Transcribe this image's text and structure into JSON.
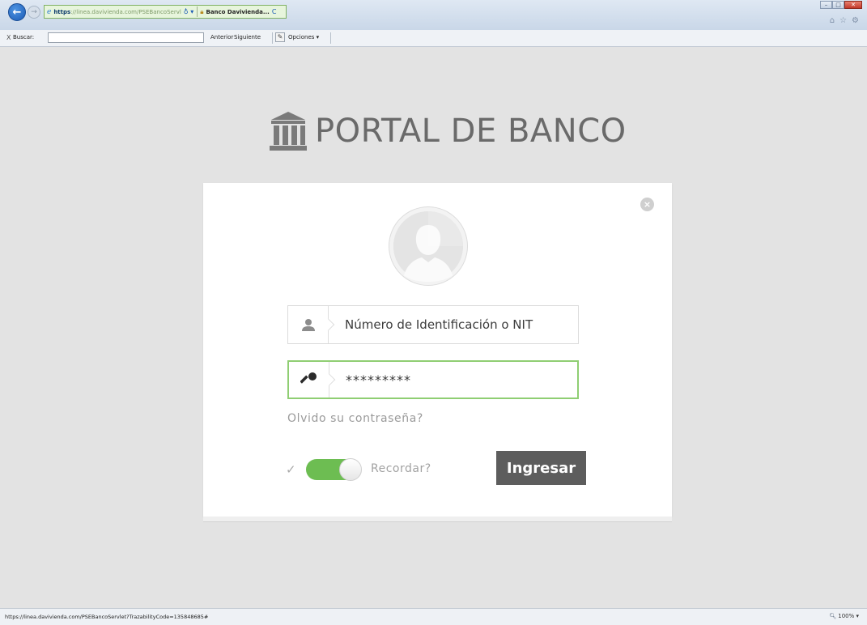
{
  "browser": {
    "url_prefix": "https",
    "url_dim": "://linea.davivienda.com/PSEBancoServl",
    "url_search": "♁ ▾",
    "tab_title": "Banco Davivienda...",
    "tab_refresh": "C",
    "win_minimize": "–",
    "win_maximize": "□",
    "win_close": "✕",
    "toolbar_icons": [
      "⌂",
      "☆",
      "⚙"
    ]
  },
  "findbar": {
    "close": "X",
    "label": "Buscar:",
    "value": "",
    "prev": "Anterior",
    "next": "Siguiente",
    "options": "Opciones ▾"
  },
  "page": {
    "brand_title": "PORTAL DE BANCO"
  },
  "login": {
    "close": "×",
    "user_placeholder": "Número de Identificación o NIT",
    "password_value": "*********",
    "forgot": "Olvido su contraseña?",
    "remember_label": "Recordar?",
    "remember_on": true,
    "check": "✓",
    "submit": "Ingresar"
  },
  "status": {
    "url": "https://linea.davivienda.com/PSEBancoServlet?TrazabilityCode=135848685#",
    "zoom": "100%",
    "zoom_arrow": "▾"
  },
  "colors": {
    "accent_green": "#6dbd52",
    "button_dark": "#5d5d5d",
    "page_bg": "#e3e3e3"
  }
}
